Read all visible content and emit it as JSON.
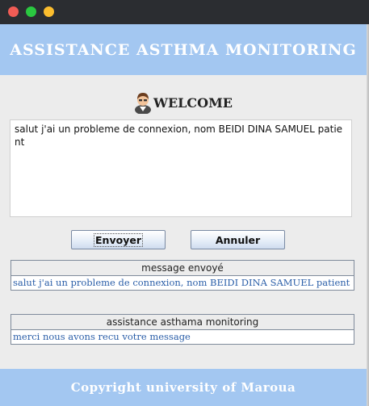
{
  "window": {
    "header_title": "ASSISTANCE ASTHMA MONITORING",
    "footer_text": "Copyright university of Maroua"
  },
  "welcome": {
    "label": "WELCOME",
    "icon": "user-avatar-icon"
  },
  "message_input": {
    "value": "salut j'ai un probleme de connexion, nom BEIDI DINA SAMUEL patient"
  },
  "buttons": {
    "send_label": "Envoyer",
    "cancel_label": "Annuler"
  },
  "sent_panel": {
    "title": "message envoyé",
    "value": "salut j'ai un probleme de connexion, nom BEIDI DINA SAMUEL patient"
  },
  "reply_panel": {
    "title": "assistance asthama monitoring",
    "value": "merci nous avons recu votre message"
  },
  "colors": {
    "header_blue": "#a3c7f1",
    "field_text_blue": "#2a5ea8"
  }
}
